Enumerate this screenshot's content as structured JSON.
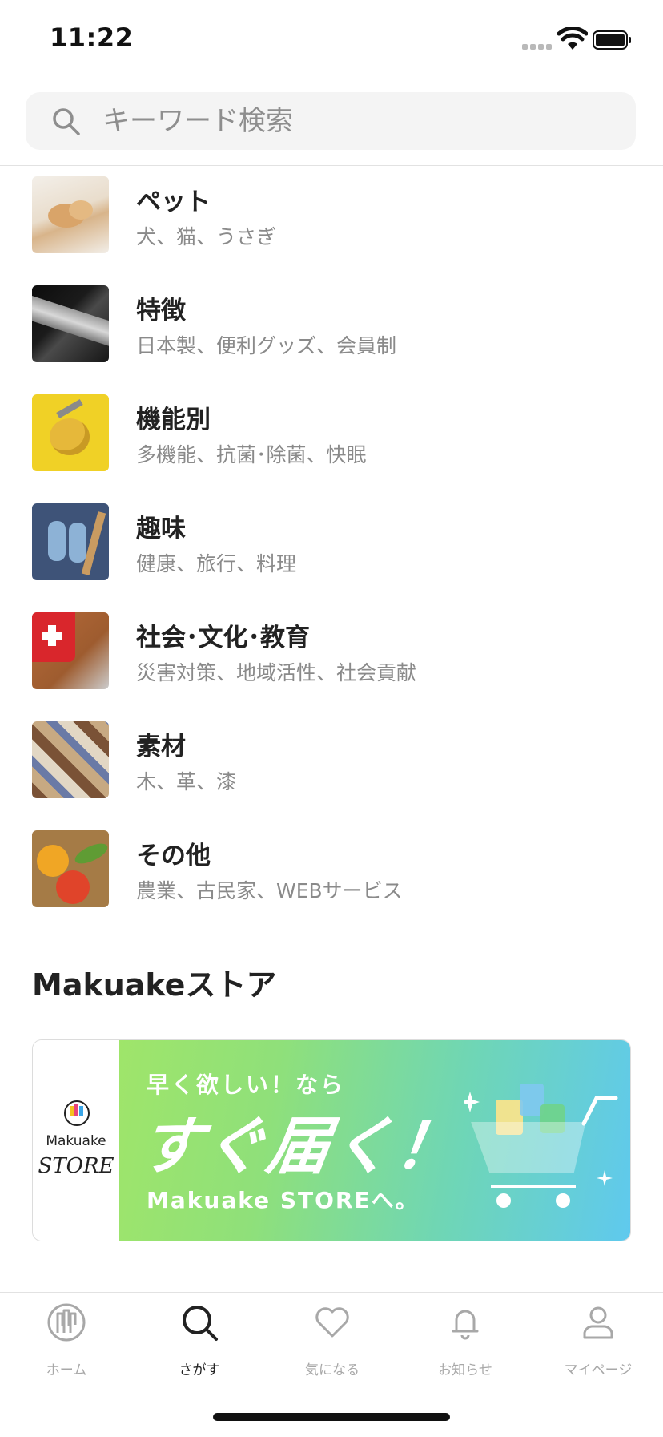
{
  "status_bar": {
    "time": "11:22"
  },
  "search": {
    "placeholder": "キーワード検索"
  },
  "categories": [
    {
      "name": "ペット",
      "sub": "犬、猫、うさぎ"
    },
    {
      "name": "特徴",
      "sub": "日本製、便利グッズ、会員制"
    },
    {
      "name": "機能別",
      "sub": "多機能、抗菌･除菌、快眠"
    },
    {
      "name": "趣味",
      "sub": "健康、旅行、料理"
    },
    {
      "name": "社会･文化･教育",
      "sub": "災害対策、地域活性、社会貢献"
    },
    {
      "name": "素材",
      "sub": "木、革、漆"
    },
    {
      "name": "その他",
      "sub": "農業、古民家、WEBサービス"
    }
  ],
  "store": {
    "title": "Makuakeストア",
    "logo_line1": "Makuake",
    "logo_line2": "STORE",
    "promo_top": "早く欲しい！なら",
    "promo_main": "すぐ届く！",
    "promo_bottom": "Makuake STOREへ。"
  },
  "tabs": [
    {
      "label": "ホーム",
      "icon": "home-icon"
    },
    {
      "label": "さがす",
      "icon": "search-icon"
    },
    {
      "label": "気になる",
      "icon": "heart-icon"
    },
    {
      "label": "お知らせ",
      "icon": "bell-icon"
    },
    {
      "label": "マイページ",
      "icon": "person-icon"
    }
  ],
  "colors": {
    "accent": "#222222",
    "inactive": "#a8a8a8",
    "banner_start": "#9fe56a",
    "banner_end": "#5fc9ee"
  }
}
